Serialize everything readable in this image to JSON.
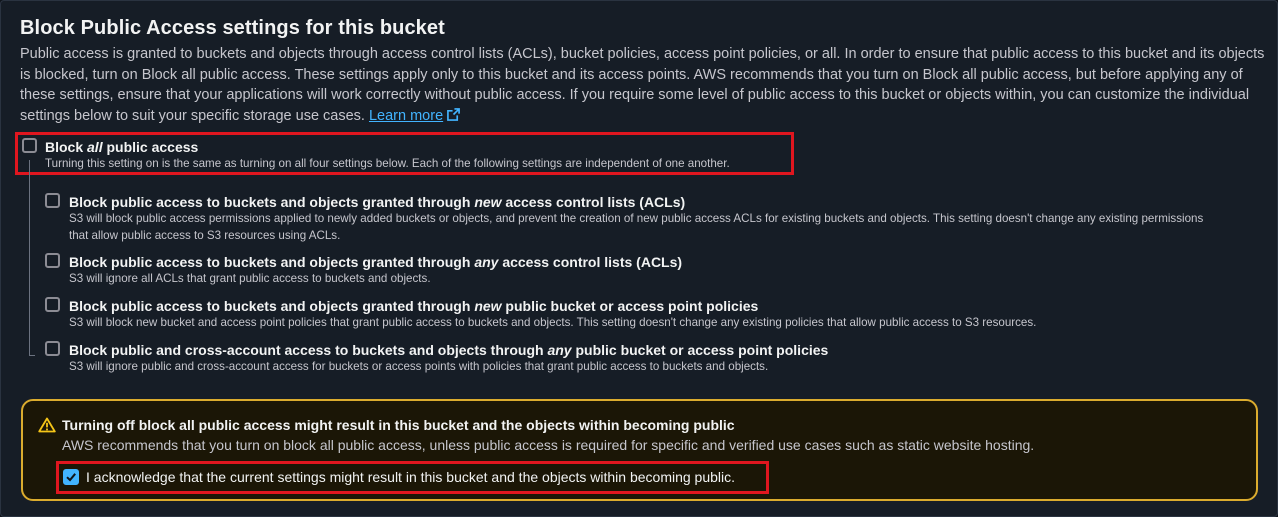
{
  "section": {
    "title": "Block Public Access settings for this bucket",
    "description": "Public access is granted to buckets and objects through access control lists (ACLs), bucket policies, access point policies, or all. In order to ensure that public access to this bucket and its objects is blocked, turn on Block all public access. These settings apply only to this bucket and its access points. AWS recommends that you turn on Block all public access, but before applying any of these settings, ensure that your applications will work correctly without public access. If you require some level of public access to this bucket or objects within, you can customize the individual settings below to suit your specific storage use cases.",
    "learn_more": "Learn more"
  },
  "block_all": {
    "label_pre": "Block ",
    "label_em": "all",
    "label_post": " public access",
    "description": "Turning this setting on is the same as turning on all four settings below. Each of the following settings are independent of one another.",
    "checked": false
  },
  "options": [
    {
      "label_pre": "Block public access to buckets and objects granted through ",
      "label_em": "new",
      "label_post": " access control lists (ACLs)",
      "description": "S3 will block public access permissions applied to newly added buckets or objects, and prevent the creation of new public access ACLs for existing buckets and objects. This setting doesn't change any existing permissions that allow public access to S3 resources using ACLs.",
      "checked": false
    },
    {
      "label_pre": "Block public access to buckets and objects granted through ",
      "label_em": "any",
      "label_post": " access control lists (ACLs)",
      "description": "S3 will ignore all ACLs that grant public access to buckets and objects.",
      "checked": false
    },
    {
      "label_pre": "Block public access to buckets and objects granted through ",
      "label_em": "new",
      "label_post": " public bucket or access point policies",
      "description": "S3 will block new bucket and access point policies that grant public access to buckets and objects. This setting doesn't change any existing policies that allow public access to S3 resources.",
      "checked": false
    },
    {
      "label_pre": "Block public and cross-account access to buckets and objects through ",
      "label_em": "any",
      "label_post": " public bucket or access point policies",
      "description": "S3 will ignore public and cross-account access for buckets or access points with policies that grant public access to buckets and objects.",
      "checked": false
    }
  ],
  "warning": {
    "icon": "warning-triangle-icon",
    "title": "Turning off block all public access might result in this bucket and the objects within becoming public",
    "description": "AWS recommends that you turn on block all public access, unless public access is required for specific and verified use cases such as static website hosting.",
    "acknowledge_label": "I acknowledge that the current settings might result in this bucket and the objects within becoming public.",
    "acknowledge_checked": true
  },
  "colors": {
    "accent": "#42b4ff",
    "warning_border": "#dbac2e",
    "highlight_box": "#e0161f"
  }
}
